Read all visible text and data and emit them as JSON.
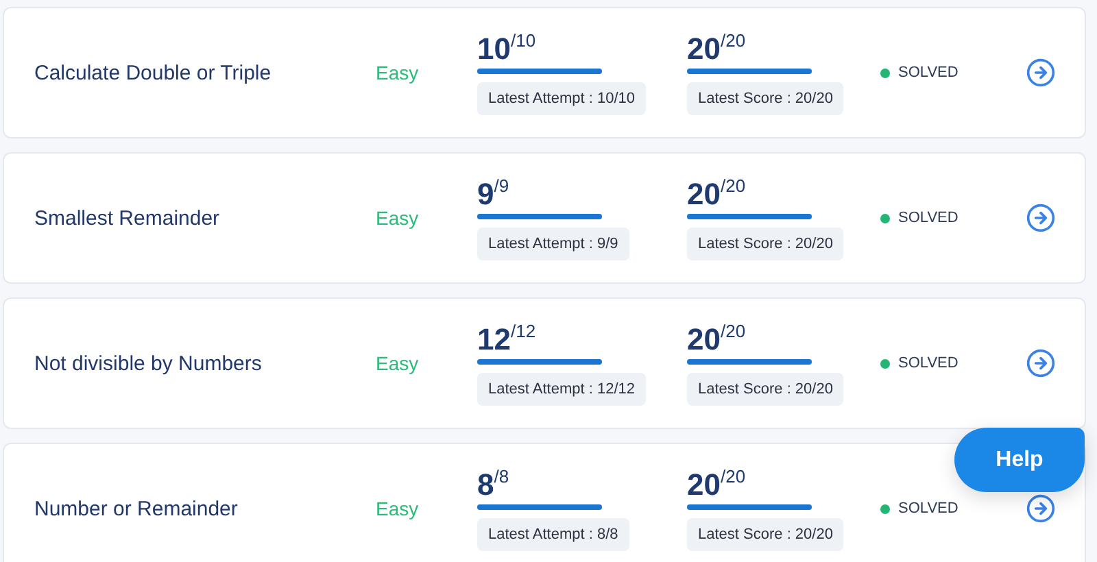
{
  "problems": [
    {
      "title": "Calculate Double or Triple",
      "difficulty": "Easy",
      "attempt": {
        "value": "10",
        "total": "/10",
        "level": 1,
        "label": "Latest Attempt : 10/10"
      },
      "score": {
        "value": "20",
        "total": "/20",
        "level": 1,
        "label": "Latest Score : 20/20"
      },
      "status": "SOLVED",
      "solved": true
    },
    {
      "title": "Smallest Remainder",
      "difficulty": "Easy",
      "attempt": {
        "value": "9",
        "total": "/9",
        "level": 1,
        "label": "Latest Attempt : 9/9"
      },
      "score": {
        "value": "20",
        "total": "/20",
        "level": 1,
        "label": "Latest Score : 20/20"
      },
      "status": "SOLVED",
      "solved": true
    },
    {
      "title": "Not divisible by Numbers",
      "difficulty": "Easy",
      "attempt": {
        "value": "12",
        "total": "/12",
        "level": 1,
        "label": "Latest Attempt : 12/12"
      },
      "score": {
        "value": "20",
        "total": "/20",
        "level": 1,
        "label": "Latest Score : 20/20"
      },
      "status": "SOLVED",
      "solved": true
    },
    {
      "title": "Number or Remainder",
      "difficulty": "Easy",
      "attempt": {
        "value": "8",
        "total": "/8",
        "level": 1,
        "label": "Latest Attempt : 8/8"
      },
      "score": {
        "value": "20",
        "total": "/20",
        "level": 1,
        "label": "Latest Score : 20/20"
      },
      "status": "SOLVED",
      "solved": true
    }
  ],
  "help_button": "Help"
}
